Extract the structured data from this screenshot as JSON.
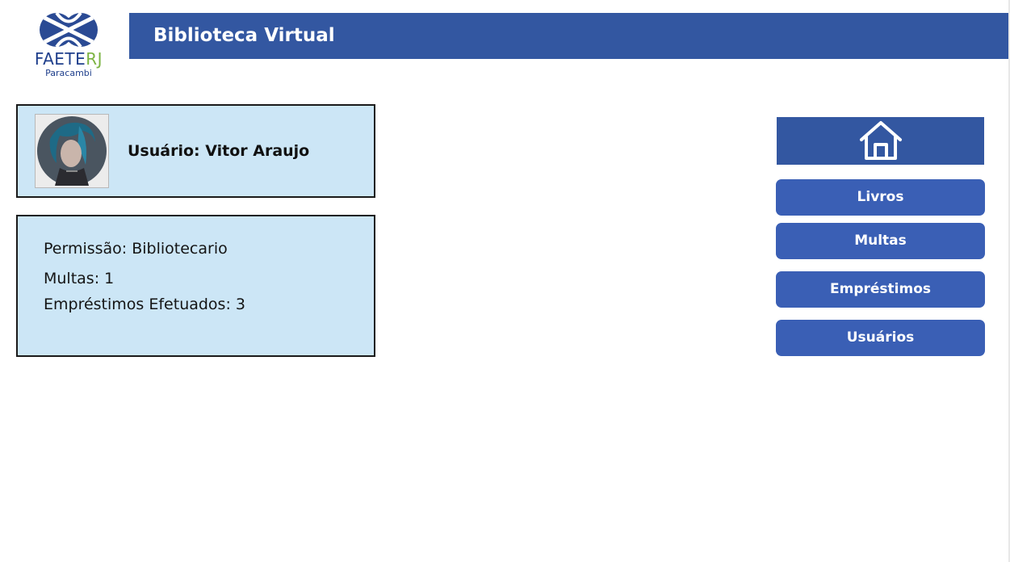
{
  "logo": {
    "word_main": "FAETE",
    "word_accent": "RJ",
    "sub": "Paracambi",
    "colors": {
      "blue": "#1f3f8c",
      "green": "#7cb342"
    }
  },
  "header": {
    "title": "Biblioteca Virtual",
    "background": "#3357a1"
  },
  "user_card": {
    "name_label": "Usuário: Vitor Araujo",
    "avatar_icon": "user-avatar-photo"
  },
  "info_card": {
    "permission": "Permissão: Bibliotecario",
    "fines": "Multas: 1",
    "loans": "Empréstimos Efetuados: 3"
  },
  "nav": {
    "home_icon": "home-icon",
    "buttons": [
      {
        "label": "Livros"
      },
      {
        "label": "Multas"
      },
      {
        "label": "Empréstimos"
      },
      {
        "label": "Usuários"
      }
    ],
    "button_color": "#3a5fb5"
  },
  "colors": {
    "card_background": "#cce6f6",
    "card_border": "#1a1a1a"
  }
}
